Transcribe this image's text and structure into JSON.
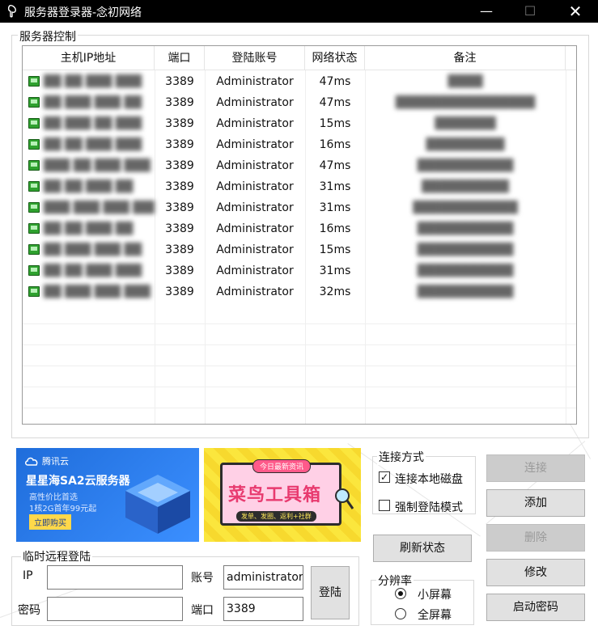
{
  "window": {
    "title": "服务器登录器-念初网络",
    "minimize_glyph": "—",
    "maximize_glyph": "☐",
    "close_glyph": "✕"
  },
  "server_group": {
    "label": "服务器控制",
    "columns": [
      "主机IP地址",
      "端口",
      "登陆账号",
      "网络状态",
      "备注"
    ],
    "rows": [
      {
        "port": "3389",
        "account": "Administrator",
        "status": "47ms"
      },
      {
        "port": "3389",
        "account": "Administrator",
        "status": "47ms"
      },
      {
        "port": "3389",
        "account": "Administrator",
        "status": "15ms"
      },
      {
        "port": "3389",
        "account": "Administrator",
        "status": "16ms"
      },
      {
        "port": "3389",
        "account": "Administrator",
        "status": "47ms"
      },
      {
        "port": "3389",
        "account": "Administrator",
        "status": "31ms"
      },
      {
        "port": "3389",
        "account": "Administrator",
        "status": "31ms"
      },
      {
        "port": "3389",
        "account": "Administrator",
        "status": "16ms"
      },
      {
        "port": "3389",
        "account": "Administrator",
        "status": "15ms"
      },
      {
        "port": "3389",
        "account": "Administrator",
        "status": "31ms"
      },
      {
        "port": "3389",
        "account": "Administrator",
        "status": "32ms"
      }
    ]
  },
  "ads": {
    "tencent": {
      "brand": "腾讯云",
      "headline": "星星海SA2云服务器",
      "sub1": "高性价比首选",
      "sub2": "1核2G首年99元起",
      "cta": "立即购买"
    },
    "cainiao": {
      "tag": "今日最新资讯",
      "headline": "菜鸟工具箱",
      "sub": "发单、发圈、返利+社群"
    }
  },
  "connect_mode": {
    "label": "连接方式",
    "local_disk_label": "连接本地磁盘",
    "local_disk_checked": true,
    "force_login_label": "强制登陆模式",
    "force_login_checked": false,
    "check_glyph": "✓"
  },
  "buttons": {
    "connect": "连接",
    "add": "添加",
    "delete": "删除",
    "refresh": "刷新状态",
    "modify": "修改",
    "start_password": "启动密码",
    "login": "登陆"
  },
  "resolution": {
    "label": "分辨率",
    "small": "小屏幕",
    "full": "全屏幕",
    "selected": "small"
  },
  "temp_login": {
    "label": "临时远程登陆",
    "ip_label": "IP",
    "ip_value": "",
    "account_label": "账号",
    "account_value": "administrator",
    "password_label": "密码",
    "password_value": "",
    "port_label": "端口",
    "port_value": "3389"
  }
}
